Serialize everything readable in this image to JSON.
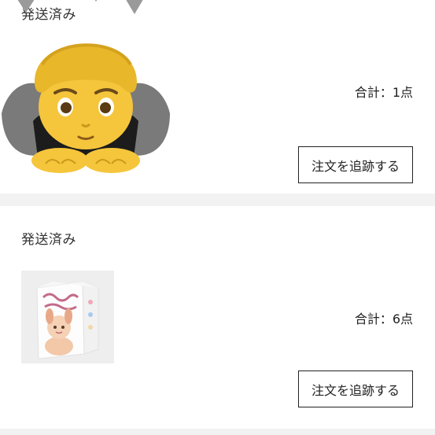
{
  "orders": [
    {
      "status": "発送済み",
      "total": "合計：1点",
      "track_label": "注文を追跡する"
    },
    {
      "status": "発送済み",
      "total": "合計：6点",
      "track_label": "注文を追跡する"
    }
  ],
  "stickers": {
    "bowing_person": "person-bowing-emoji"
  },
  "colors": {
    "divider": "#f2f2f2",
    "button_border": "#222222",
    "emoji_skin": "#f5c53b",
    "emoji_hair": "#e8b72a"
  }
}
